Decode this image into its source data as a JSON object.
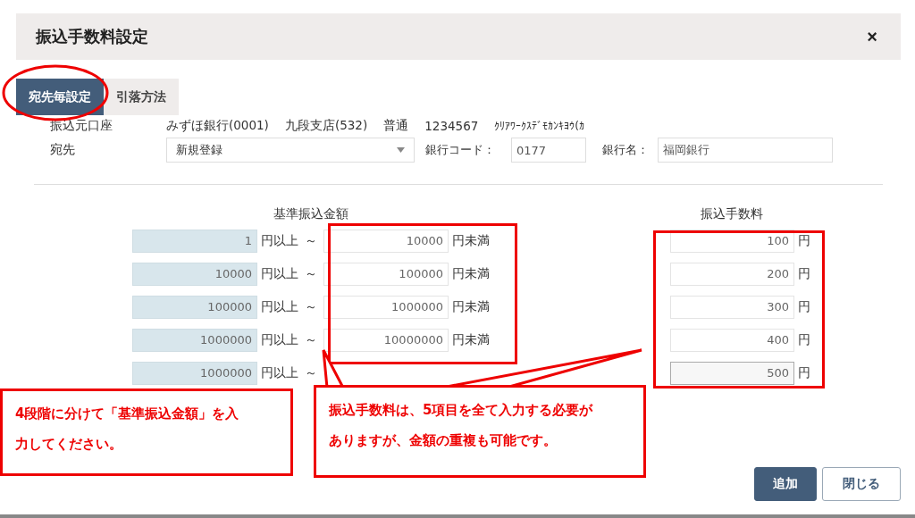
{
  "dialog": {
    "title": "振込手数料設定",
    "close": "×"
  },
  "tabs": [
    {
      "label": "宛先毎設定",
      "selected": true
    },
    {
      "label": "引落方法",
      "selected": false
    }
  ],
  "source_account": {
    "label": "振込元口座",
    "bank": "みずほ銀行(0001)",
    "branch": "九段支店(532)",
    "type": "普通",
    "number": "1234567",
    "holder": "ｸﾘｱﾜｰｸｽﾃﾞﾓｶﾝｷﾖｳ(ｶ"
  },
  "destination": {
    "label": "宛先",
    "value": "新規登録",
    "bank_code_label": "銀行コード：",
    "bank_code": "0177",
    "bank_name_label": "銀行名：",
    "bank_name": "福岡銀行"
  },
  "amount_heading": "基準振込金額",
  "fee_heading": "振込手数料",
  "tiers": [
    {
      "from": "1",
      "from_unit": "円以上",
      "tilde": "～",
      "to": "10000",
      "to_unit": "円未満",
      "fee": "100",
      "fee_unit": "円"
    },
    {
      "from": "10000",
      "from_unit": "円以上",
      "tilde": "～",
      "to": "100000",
      "to_unit": "円未満",
      "fee": "200",
      "fee_unit": "円"
    },
    {
      "from": "100000",
      "from_unit": "円以上",
      "tilde": "～",
      "to": "1000000",
      "to_unit": "円未満",
      "fee": "300",
      "fee_unit": "円"
    },
    {
      "from": "1000000",
      "from_unit": "円以上",
      "tilde": "～",
      "to": "10000000",
      "to_unit": "円未満",
      "fee": "400",
      "fee_unit": "円"
    },
    {
      "from": "1000000",
      "from_unit": "円以上",
      "tilde": "～",
      "fee": "500",
      "fee_unit": "円"
    }
  ],
  "callouts": [
    {
      "text": "4段階に分けて「基準振込金額」を入力してください。"
    },
    {
      "text": "振込手数料は、5項目を全て入力する必要がありますが、金額の重複も可能です。"
    }
  ],
  "buttons": [
    {
      "label": "追加",
      "kind": "primary"
    },
    {
      "label": "閉じる",
      "kind": "secondary"
    }
  ]
}
